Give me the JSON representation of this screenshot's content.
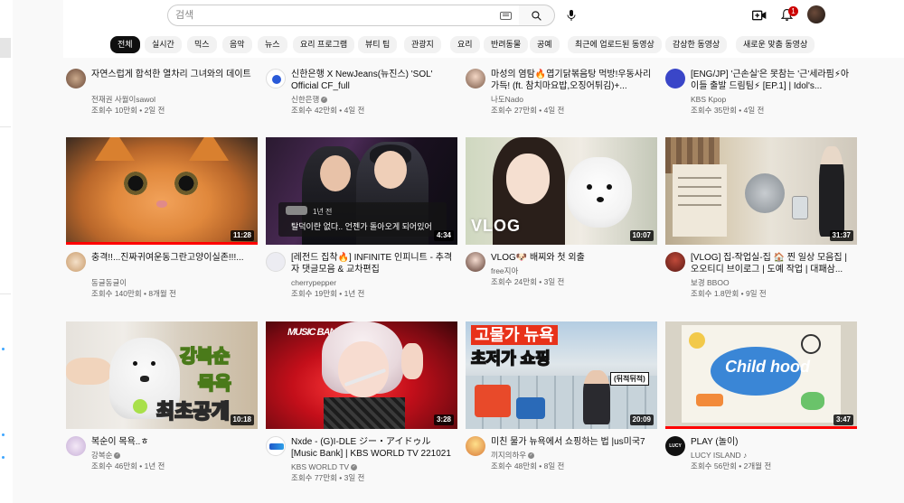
{
  "search": {
    "placeholder": "검색"
  },
  "notifications": {
    "count": "1"
  },
  "chips": [
    {
      "label": "전체",
      "active": true
    },
    {
      "label": "실시간"
    },
    {
      "label": "믹스"
    },
    {
      "label": "음악"
    },
    {
      "label": "뉴스"
    },
    {
      "label": "요리 프로그램"
    },
    {
      "label": "뷰티 팁"
    },
    {
      "label": "관광지"
    },
    {
      "label": "요리"
    },
    {
      "label": "반려동물"
    },
    {
      "label": "공예"
    },
    {
      "label": "최근에 업로드된 동영상"
    },
    {
      "label": "감상한 동영상"
    },
    {
      "label": "새로운 맞춤 동영상"
    }
  ],
  "top_row": [
    {
      "title": "자연스럽게 합석한 열차리 그녀와의 데이트",
      "channel": "전재권 사월이sawol",
      "stats": "조회수 10만회 • 2일 전"
    },
    {
      "title": "신한은행 X NewJeans(뉴진스) 'SOL' Official CF_full",
      "channel": "신한은행",
      "verified": true,
      "stats": "조회수 42만회 • 4일 전"
    },
    {
      "title": "마성의 염탐🔥엽기닭볶음탕 먹방!우동사리 가득! (ft. 참치마요밥,오징어튀김)+...",
      "channel": "나도Nado",
      "stats": "조회수 27만회 • 4일 전"
    },
    {
      "title": "[ENG/JP] '근손실'은 못참는 '근'세라핌⚡아이들 출발 드림팀⚡ [EP.1] | Idol's...",
      "channel": "KBS Kpop",
      "stats": "조회수 35만회 • 4일 전"
    }
  ],
  "videos": [
    {
      "title": "충격!!...진짜귀여운동그란고양이실존!!!...",
      "channel": "동글동글이",
      "stats": "조회수 140만회 • 8개월 전",
      "duration": "11:28",
      "progress": 1.0
    },
    {
      "title": "[레전드 집착🔥] INFINITE 인피니트 - 추격자 댓글모음 & 교차편집",
      "channel": "cherrypepper",
      "stats": "조회수 19만회 • 1년 전",
      "duration": "4:34",
      "overlay_time": "1년 전",
      "overlay_text": "탈덕이란 없다.. 언젠가 돌아오게 되어있어"
    },
    {
      "title": "VLOG🐶 배찌와 첫 외출",
      "channel": "free지아",
      "stats": "조회수 24만회 • 3일 전",
      "duration": "10:07",
      "thumb_text": "VLOG"
    },
    {
      "title": "[VLOG] 집-작업실-집 🏠 찐 일상 모음집 | 오오티디 브이로그 | 도예 작업 | 대패삼...",
      "channel": "보경 BBOO",
      "stats": "조회수 1.8만회 • 9일 전",
      "duration": "31:37"
    },
    {
      "title": "복순이 목욕..ㅎ",
      "channel": "강복순",
      "verified": true,
      "stats": "조회수 46만회 • 1년 전",
      "duration": "10:18",
      "thumb_lines": [
        "강복순",
        "목욕",
        "최초공개"
      ]
    },
    {
      "title": "Nxde - (G)I-DLE ジー・アイドゥル [Music Bank] | KBS WORLD TV 221021",
      "channel": "KBS WORLD TV",
      "verified": true,
      "stats": "조회수 77만회 • 3일 전",
      "duration": "3:28",
      "thumb_logo": "MUSIC BANK"
    },
    {
      "title": "미친 물가 뉴욕에서 쇼핑하는 법 |us미국7",
      "channel": "끼지의하우",
      "verified": true,
      "stats": "조회수 48만회 • 8일 전",
      "duration": "20:09",
      "thumb_lines": [
        "고물가 뉴욕",
        "초저가 쇼핑"
      ],
      "thumb_tag": "(뒤적뒤적)"
    },
    {
      "title": "PLAY (놀이)",
      "channel": "LUCY ISLAND",
      "music": true,
      "stats": "조회수 56만회 • 2개월 전",
      "duration": "3:47",
      "thumb_text": "Child hood",
      "progress": 1.0
    }
  ],
  "colors": {
    "accent": "#ff0000",
    "badge": "#cc0000",
    "chip_active": "#0f0f0f"
  }
}
